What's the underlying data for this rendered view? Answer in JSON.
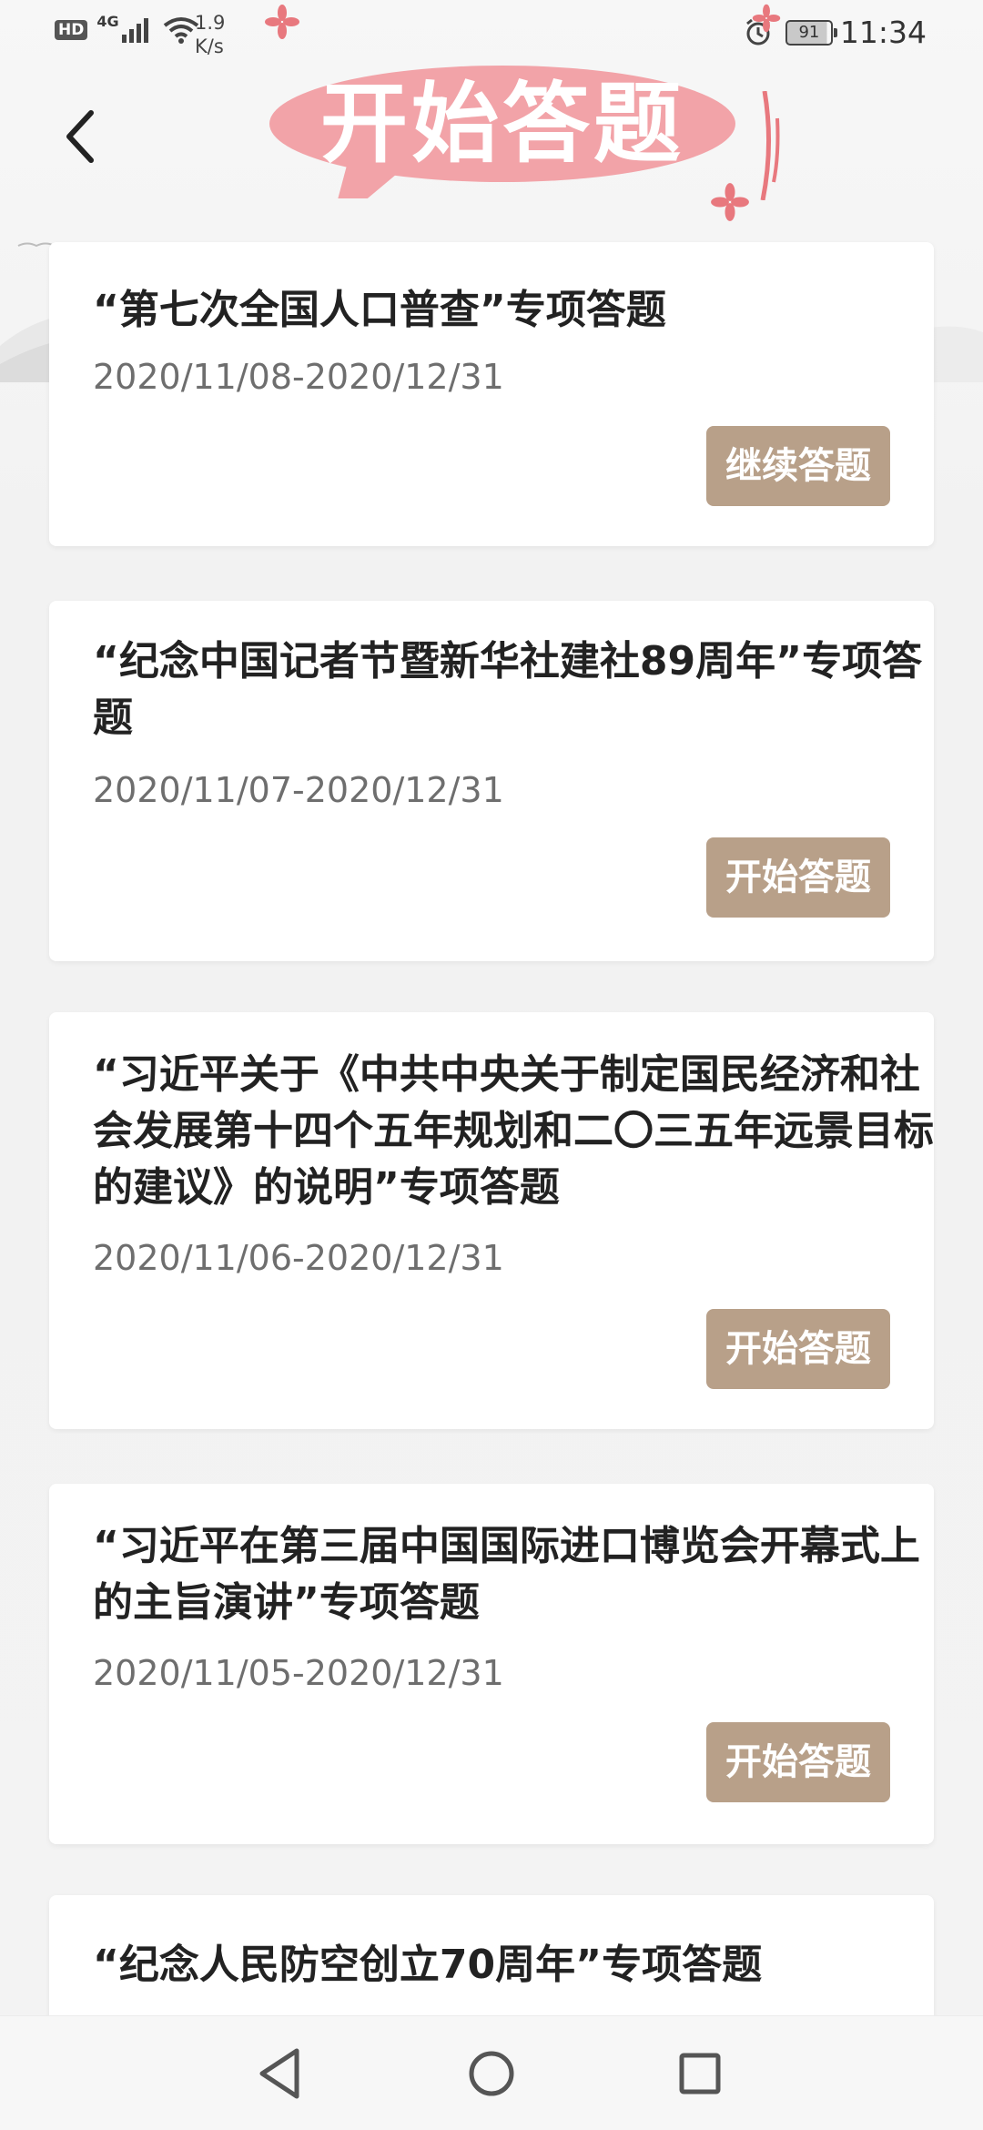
{
  "status_bar": {
    "hd_label": "HD",
    "network_label": "4G",
    "speed_value": "1.9",
    "speed_unit": "K/s",
    "battery": "91",
    "time": "11:34"
  },
  "header": {
    "title": "开始答题"
  },
  "cards": [
    {
      "title": "“第七次全国人口普查”专项答题",
      "date_range": "2020/11/08-2020/12/31",
      "button_label": "继续答题"
    },
    {
      "title": "“纪念中国记者节暨新华社建社89周年”专项答题",
      "date_range": "2020/11/07-2020/12/31",
      "button_label": "开始答题"
    },
    {
      "title": "“习近平关于《中共中央关于制定国民经济和社会发展第十四个五年规划和二〇三五年远景目标的建议》的说明”专项答题",
      "date_range": "2020/11/06-2020/12/31",
      "button_label": "开始答题"
    },
    {
      "title": "“习近平在第三届中国国际进口博览会开幕式上的主旨演讲”专项答题",
      "date_range": "2020/11/05-2020/12/31",
      "button_label": "开始答题"
    },
    {
      "title": "“纪念人民防空创立70周年”专项答题"
    }
  ],
  "colors": {
    "button_bg": "#b8a089",
    "bubble_pink": "#f2a3a8",
    "flower_pink": "#e8787e"
  },
  "icons": {
    "back": "chevron-left-icon",
    "nav_back": "triangle-back-icon",
    "nav_home": "circle-home-icon",
    "nav_recents": "square-recents-icon"
  }
}
